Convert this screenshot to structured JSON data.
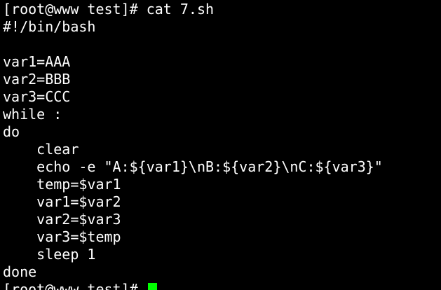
{
  "terminal": {
    "lines": [
      "[root@www test]# cat 7.sh",
      "#!/bin/bash",
      "",
      "var1=AAA",
      "var2=BBB",
      "var3=CCC",
      "while :",
      "do",
      "    clear",
      "    echo -e \"A:${var1}\\nB:${var2}\\nC:${var3}\"",
      "    temp=$var1",
      "    var1=$var2",
      "    var2=$var3",
      "    var3=$temp",
      "    sleep 1",
      "done"
    ],
    "prompt": "[root@www test]#",
    "colors": {
      "background": "#000000",
      "text": "#ffffff",
      "cursor": "#00ff00"
    }
  }
}
